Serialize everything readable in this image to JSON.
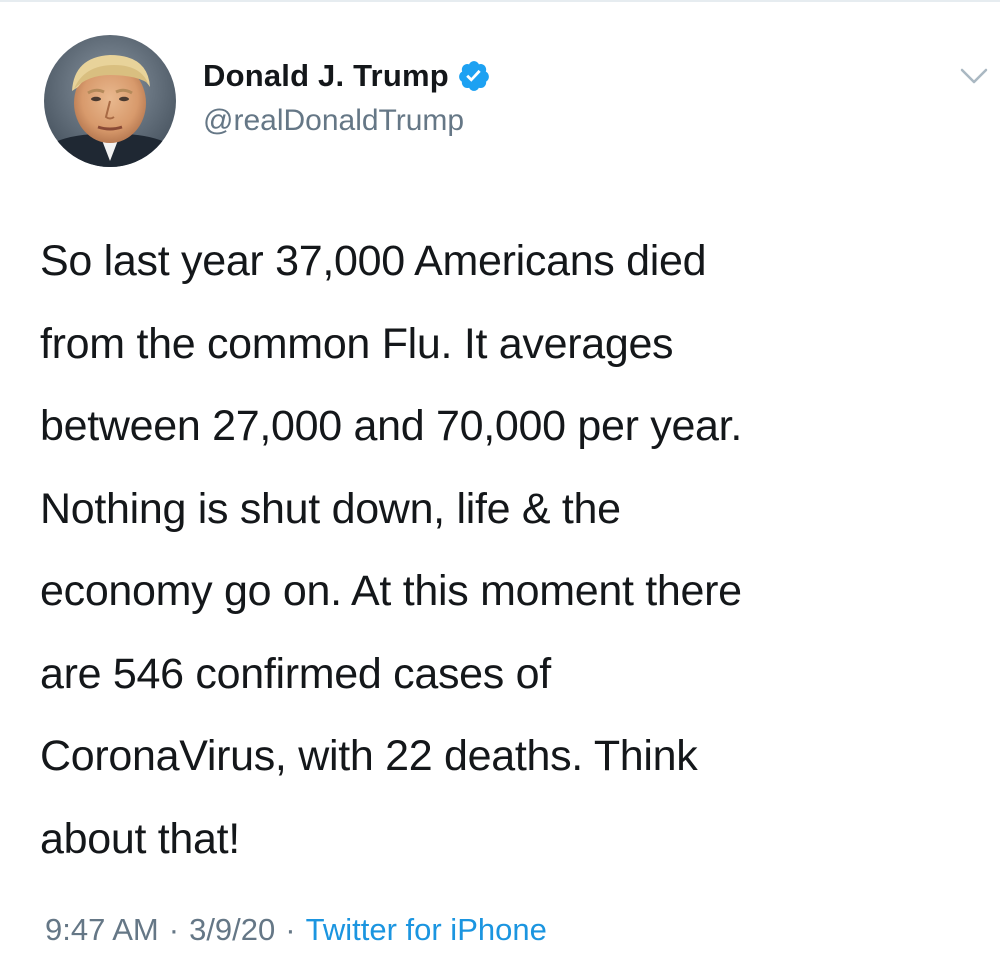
{
  "tweet": {
    "author": {
      "display_name": "Donald J. Trump",
      "handle": "@realDonaldTrump",
      "avatar_icon": "profile-photo",
      "verified_icon": "verified-badge-icon"
    },
    "body_lines": [
      "So last year 37,000 Americans died",
      "from the common Flu. It averages",
      "between 27,000 and 70,000 per year.",
      "Nothing is shut down, life & the",
      "economy go on. At this moment there",
      "are 546 confirmed cases of",
      "CoronaVirus, with 22 deaths. Think",
      "about that!"
    ],
    "meta": {
      "time": "9:47 AM",
      "separator": "·",
      "date": "3/9/20",
      "source": "Twitter for iPhone"
    },
    "menu_icon": "chevron-down-icon"
  },
  "colors": {
    "text_primary": "#14171a",
    "text_secondary": "#657786",
    "link": "#1b95e0",
    "verified": "#1da1f2"
  }
}
